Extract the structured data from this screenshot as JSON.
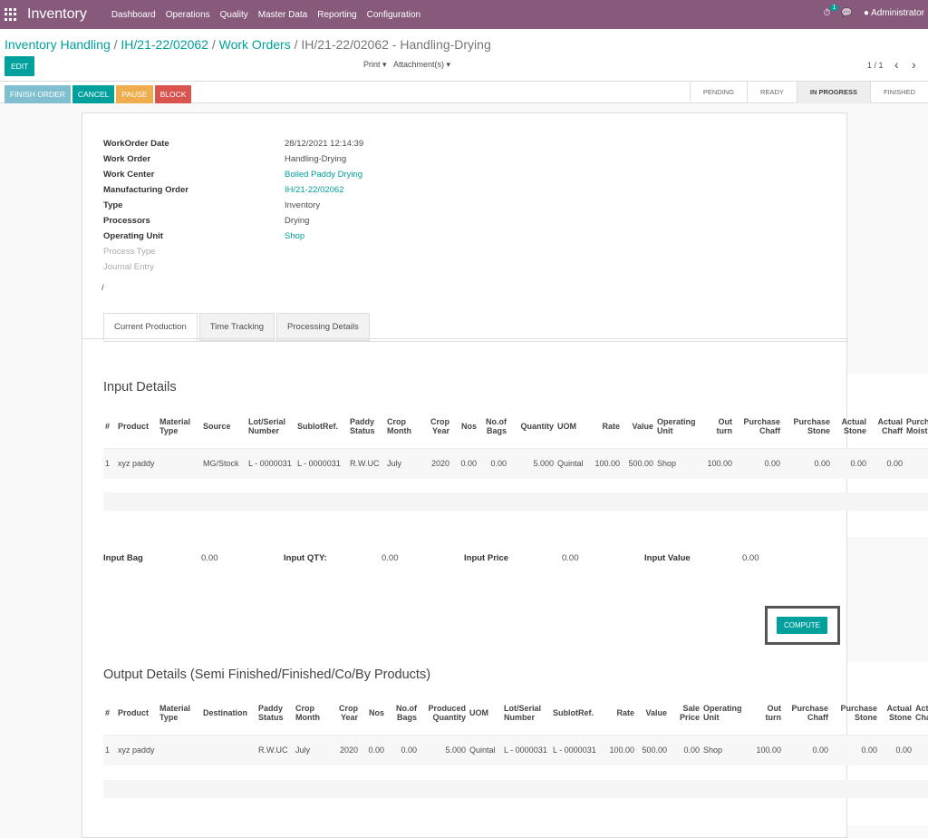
{
  "nav": {
    "brand": "Inventory",
    "menu": [
      "Dashboard",
      "Operations",
      "Quality",
      "Master Data",
      "Reporting",
      "Configuration"
    ],
    "activity_count": "1",
    "user": "Administrator"
  },
  "breadcrumb": {
    "items": [
      "Inventory Handling",
      "IH/21-22/02062",
      "Work Orders"
    ],
    "current": "IH/21-22/02062 - Handling-Drying"
  },
  "toolbar": {
    "edit": "EDIT",
    "print": "Print ▾",
    "attachments": "Attachment(s) ▾",
    "pager": "1 / 1",
    "prev": "‹",
    "next": "›"
  },
  "actions": {
    "finish": "FINISH ORDER",
    "cancel": "CANCEL",
    "pause": "PAUSE",
    "block": "BLOCK"
  },
  "stages": [
    "PENDING",
    "READY",
    "IN PROGRESS",
    "FINISHED"
  ],
  "active_stage": "IN PROGRESS",
  "fields": [
    {
      "label": "WorkOrder Date",
      "value": "28/12/2021 12:14:39",
      "link": false
    },
    {
      "label": "Work Order",
      "value": "Handling-Drying",
      "link": false
    },
    {
      "label": "Work Center",
      "value": "Boiled Paddy Drying",
      "link": true
    },
    {
      "label": "Manufacturing Order",
      "value": "IH/21-22/02062",
      "link": true
    },
    {
      "label": "Type",
      "value": "Inventory",
      "link": false
    },
    {
      "label": "Processors",
      "value": "Drying",
      "link": false
    },
    {
      "label": "Operating Unit",
      "value": "Shop",
      "link": true
    },
    {
      "label": "Process Type",
      "value": "",
      "link": false
    },
    {
      "label": "Journal Entry",
      "value": "",
      "link": false
    }
  ],
  "slash": "/",
  "tabs": [
    "Current Production",
    "Time Tracking",
    "Processing Details"
  ],
  "input": {
    "title": "Input Details",
    "headers": [
      "#",
      "Product",
      "Material Type",
      "Source",
      "Lot/Serial Number",
      "SublotRef.",
      "Paddy Status",
      "Crop Month",
      "Crop Year",
      "Nos",
      "No.of Bags",
      "Quantity",
      "UOM",
      "Rate",
      "Value",
      "Operating Unit",
      "Out turn",
      "Purchase Chaff",
      "Purchase Stone",
      "Actual Stone",
      "Actual Chaff",
      "Purchase Moisture"
    ],
    "rows": [
      [
        "1",
        "xyz paddy",
        "",
        "MG/Stock",
        "L - 0000031",
        "L - 0000031",
        "R.W.UC",
        "July",
        "2020",
        "0.00",
        "0.00",
        "5.000",
        "Quintal",
        "100.00",
        "500.00",
        "Shop",
        "100.00",
        "0.00",
        "0.00",
        "0.00",
        "0.00",
        ""
      ]
    ]
  },
  "totals": [
    {
      "label": "Input Bag",
      "value": "0.00"
    },
    {
      "label": "Input QTY:",
      "value": "0.00"
    },
    {
      "label": "Input Price",
      "value": "0.00"
    },
    {
      "label": "Input Value",
      "value": "0.00"
    }
  ],
  "compute": "COMPUTE",
  "output": {
    "title": "Output Details (Semi Finished/Finished/Co/By Products)",
    "headers": [
      "#",
      "Product",
      "Material Type",
      "Destination",
      "Paddy Status",
      "Crop Month",
      "Crop Year",
      "Nos",
      "No.of Bags",
      "Produced Quantity",
      "UOM",
      "Lot/Serial Number",
      "SublotRef.",
      "Rate",
      "Value",
      "Sale Price",
      "Operating Unit",
      "Out turn",
      "Purchase Chaff",
      "Purchase Stone",
      "Actual Stone",
      "Actual Chaff"
    ],
    "rows": [
      [
        "1",
        "xyz paddy",
        "",
        "",
        "R.W.UC",
        "July",
        "2020",
        "0.00",
        "0.00",
        "5.000",
        "Quintal",
        "L - 0000031",
        "L - 0000031",
        "100.00",
        "500.00",
        "0.00",
        "Shop",
        "100.00",
        "0.00",
        "0.00",
        "0.00",
        ""
      ]
    ]
  },
  "colors": {
    "brand": "#875a7b",
    "primary": "#00a09d",
    "finish": "#7fbfd0",
    "pause": "#f0ad4e",
    "block": "#d9534f"
  }
}
